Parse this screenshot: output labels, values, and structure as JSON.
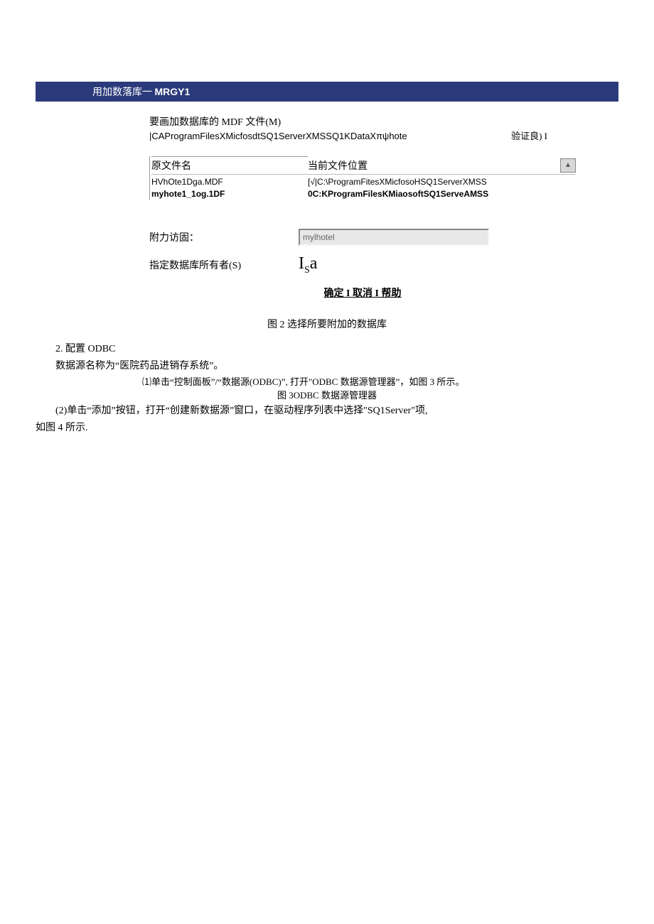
{
  "dialog": {
    "title_prefix": "用加数落库一 ",
    "title_id": "MRGY1",
    "mdf_label": "要画加数据库的 MDF 文件(M)",
    "path": "|CAProgramFilesXMicfosdtSQ1ServerXMSSQ1KDataXπψhote",
    "verify_label": "验证良) I",
    "table": {
      "header1": "原文件名",
      "header2": "当前文件位置",
      "row1_col1_a": "HVhOte1Dga.MDF",
      "row1_col1_b": "myhote1_1og.1DF",
      "row1_col2_a": "[√|C:\\ProgramFitesXMicfosoHSQ1ServerXMSS",
      "row1_col2_b": "0C:KProgramFilesKMiaosoftSQ1ServeAMSS"
    },
    "attach_label": "附力访固：",
    "attach_value": "mylhotel",
    "owner_label": "指定数据库所有者(S)",
    "owner_value_i": "I",
    "owner_value_s": "S",
    "owner_value_a": "a",
    "buttons": "确定 I 取消 I 帮助"
  },
  "captions": {
    "fig2": "图 2 选择所要附加的数据库",
    "fig3": "图 3ODBC 数据源管理器"
  },
  "text": {
    "section2": "2. 配置 ODBC",
    "datasource": "数据源名称为“医院药品进销存系统”。",
    "step1": "⑴单击“控制面板”/“数据源(ODBC)”, 打开\"ODBC 数据源管理器”，如图 3 所示。",
    "step2": "(2)单击“添加”按钮，打开“创建新数据源”窗口，在驱动程序列表中选择\"SQ1Server\"项,",
    "step2b": "如图 4 所示."
  }
}
